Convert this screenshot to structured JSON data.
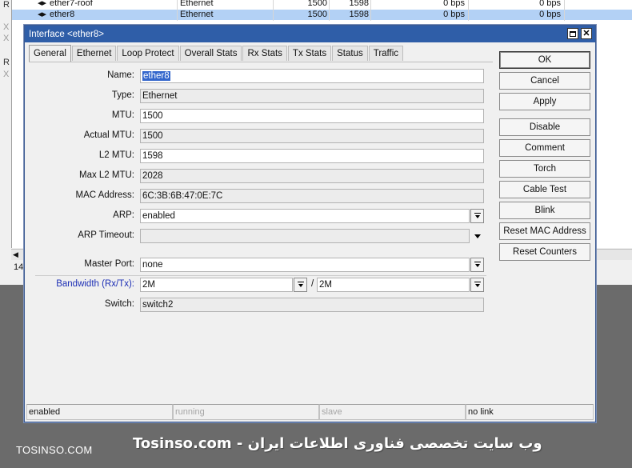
{
  "background_list": {
    "rows": [
      {
        "flag": "R",
        "name": "ether7-roof",
        "type": "Ethernet",
        "mtu": "1500",
        "l2mtu": "1598",
        "tx": "0 bps",
        "rx": "0 bps",
        "selected": false
      },
      {
        "flag": "",
        "name": "ether8",
        "type": "Ethernet",
        "mtu": "1500",
        "l2mtu": "1598",
        "tx": "0 bps",
        "rx": "0 bps",
        "selected": true
      }
    ],
    "side_flags": [
      "X",
      "X",
      "R",
      "X"
    ],
    "status_count": "14"
  },
  "dialog": {
    "title": "Interface <ether8>",
    "tabs": [
      "General",
      "Ethernet",
      "Loop Protect",
      "Overall Stats",
      "Rx Stats",
      "Tx Stats",
      "Status",
      "Traffic"
    ],
    "active_tab": "General",
    "fields": {
      "name": {
        "label": "Name:",
        "value": "ether8"
      },
      "type": {
        "label": "Type:",
        "value": "Ethernet"
      },
      "mtu": {
        "label": "MTU:",
        "value": "1500"
      },
      "actual_mtu": {
        "label": "Actual MTU:",
        "value": "1500"
      },
      "l2_mtu": {
        "label": "L2 MTU:",
        "value": "1598"
      },
      "max_l2_mtu": {
        "label": "Max L2 MTU:",
        "value": "2028"
      },
      "mac_address": {
        "label": "MAC Address:",
        "value": "6C:3B:6B:47:0E:7C"
      },
      "arp": {
        "label": "ARP:",
        "value": "enabled"
      },
      "arp_timeout": {
        "label": "ARP Timeout:",
        "value": ""
      },
      "master_port": {
        "label": "Master Port:",
        "value": "none"
      },
      "bandwidth": {
        "label": "Bandwidth (Rx/Tx):",
        "rx": "2M",
        "separator": "/",
        "tx": "2M"
      },
      "switch": {
        "label": "Switch:",
        "value": "switch2"
      }
    },
    "buttons": [
      "OK",
      "Cancel",
      "Apply",
      "Disable",
      "Comment",
      "Torch",
      "Cable Test",
      "Blink",
      "Reset MAC Address",
      "Reset Counters"
    ],
    "status_bar": [
      "enabled",
      "running",
      "slave",
      "no link"
    ]
  },
  "watermark": {
    "left": "TOSINSO.COM",
    "right": "Tosinso.com - وب سایت تخصصی فناوری اطلاعات ایران"
  },
  "colors": {
    "titlebar": "#2f5ea8",
    "selection": "#b3d1f5",
    "link_label": "#1d2fb5"
  }
}
